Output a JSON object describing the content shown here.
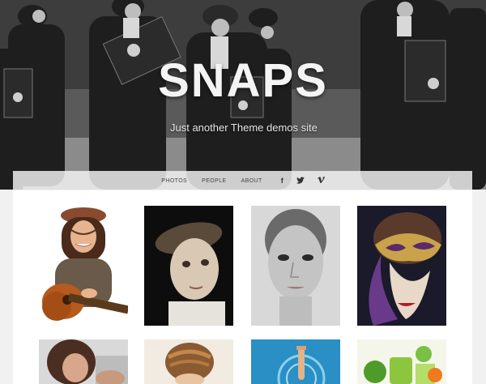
{
  "site": {
    "title": "SNAPS",
    "tagline": "Just another Theme demos site"
  },
  "menu": {
    "items": [
      {
        "label": "PHOTOS"
      },
      {
        "label": "PEOPLE"
      },
      {
        "label": "ABOUT"
      }
    ],
    "social": [
      {
        "icon": "facebook-icon",
        "glyph": "f"
      },
      {
        "icon": "twitter-icon",
        "glyph": "t"
      },
      {
        "icon": "vimeo-icon",
        "glyph": "v"
      }
    ]
  },
  "gallery": {
    "items": [
      {
        "subject": "woman-with-guitar"
      },
      {
        "subject": "child-portrait"
      },
      {
        "subject": "woman-face-portrait"
      },
      {
        "subject": "masquerade-mask"
      },
      {
        "subject": "woman-portrait"
      },
      {
        "subject": "braided-hair"
      },
      {
        "subject": "water-splash"
      },
      {
        "subject": "green-drink"
      }
    ]
  }
}
